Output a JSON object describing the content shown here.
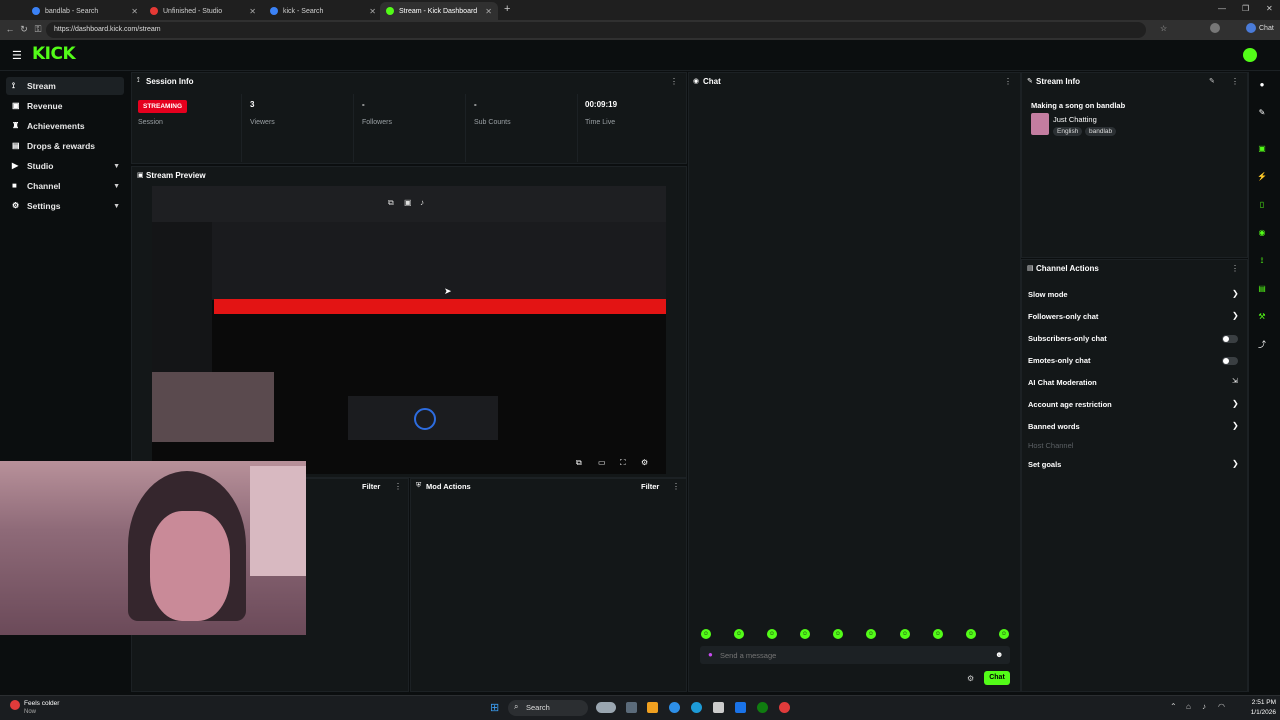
{
  "browser": {
    "tabs": [
      {
        "label": "bandlab - Search",
        "icon": "bing-icon"
      },
      {
        "label": "Unfinished - Studio",
        "icon": "bandlab-icon"
      },
      {
        "label": "kick - Search",
        "icon": "bing-icon"
      },
      {
        "label": "Stream - Kick Dashboard",
        "icon": "kick-icon"
      }
    ],
    "url": "https://dashboard.kick.com/stream",
    "profile_label": "Chat"
  },
  "brand": {
    "logo_text": "KICK",
    "accent": "#53fc18"
  },
  "sidebar": {
    "items": [
      {
        "label": "Stream"
      },
      {
        "label": "Revenue"
      },
      {
        "label": "Achievements"
      },
      {
        "label": "Drops & rewards"
      },
      {
        "label": "Studio"
      },
      {
        "label": "Channel"
      },
      {
        "label": "Settings"
      }
    ]
  },
  "session": {
    "title": "Session Info",
    "status_badge": "STREAMING",
    "status_label": "Session",
    "stats": [
      {
        "value": "3",
        "label": "Viewers"
      },
      {
        "value": "-",
        "label": "Followers"
      },
      {
        "value": "-",
        "label": "Sub Counts"
      },
      {
        "value": "00:09:19",
        "label": "Time Live"
      }
    ]
  },
  "preview": {
    "title": "Stream Preview"
  },
  "lower": {
    "left_filter": "Filter",
    "mod_title": "Mod Actions",
    "mod_filter": "Filter"
  },
  "chat": {
    "title": "Chat",
    "placeholder": "Send a message",
    "send_label": "Chat"
  },
  "stream_info": {
    "title": "Stream Info",
    "stream_title": "Making a song on bandlab",
    "category": "Just Chatting",
    "tags": [
      "English",
      "bandlab"
    ]
  },
  "channel_actions": {
    "title": "Channel Actions",
    "items": [
      {
        "label": "Slow mode",
        "control": "arrow"
      },
      {
        "label": "Followers-only chat",
        "control": "arrow"
      },
      {
        "label": "Subscribers-only chat",
        "control": "toggle"
      },
      {
        "label": "Emotes-only chat",
        "control": "toggle"
      },
      {
        "label": "AI Chat Moderation",
        "control": "external"
      },
      {
        "label": "Account age restriction",
        "control": "arrow"
      },
      {
        "label": "Banned words",
        "control": "arrow"
      },
      {
        "label": "Host Channel",
        "control": "none",
        "disabled": true
      },
      {
        "label": "Set goals",
        "control": "arrow"
      }
    ]
  },
  "taskbar": {
    "weather_title": "Feels colder",
    "weather_sub": "Now",
    "search_label": "Search",
    "time": "2:51 PM",
    "date": "1/1/2026"
  }
}
